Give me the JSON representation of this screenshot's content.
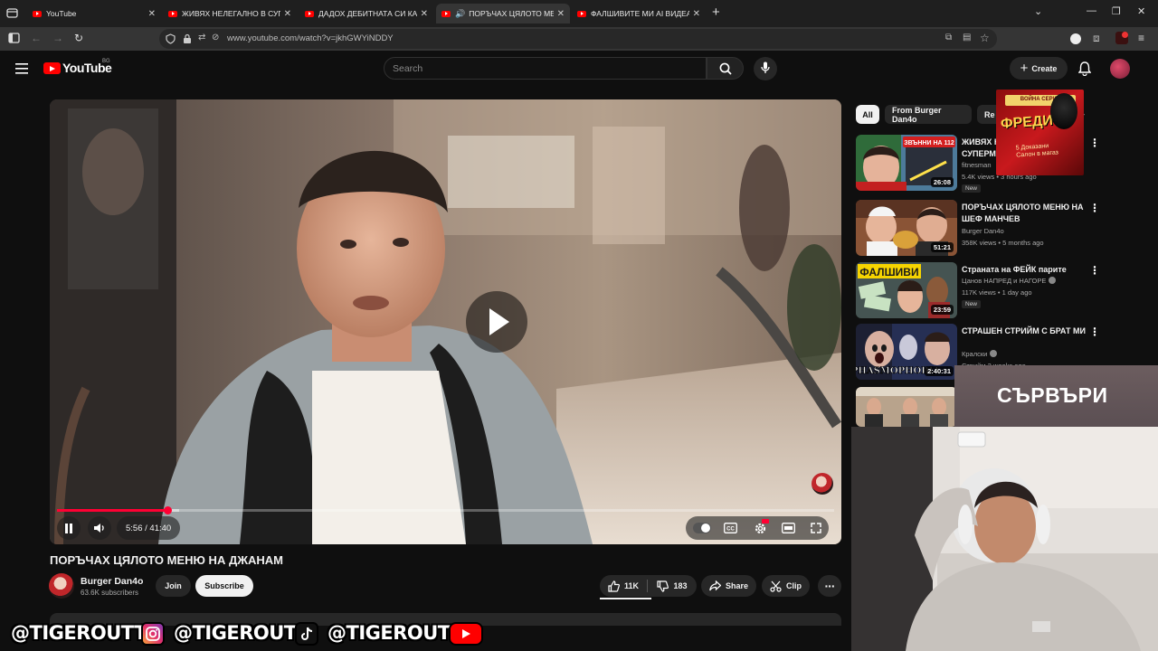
{
  "browser": {
    "tabs": [
      {
        "title": "YouTube"
      },
      {
        "title": "ЖИВЯХ НЕЛЕГАЛНО В СУПЕРМАРКЕТ"
      },
      {
        "title": "ДАДОХ ДЕБИТНАТА СИ КАРТА"
      },
      {
        "title": "ПОРЪЧАХ ЦЯЛОТО МЕНЮ НА ДЖАНАМ"
      },
      {
        "title": "ФАЛШИВИТЕ МИ AI ВИДЕА З..."
      }
    ],
    "new_tab": "+",
    "url": "www.youtube.com/watch?v=jkhGWYiNDDY"
  },
  "header": {
    "logo_text": "YouTube",
    "country": "BG",
    "search_placeholder": "Search",
    "create_label": "Create"
  },
  "player": {
    "time": "5:56 / 41:40",
    "progress": 0.142,
    "buffered": 0.157
  },
  "video": {
    "title": "ПОРЪЧАХ ЦЯЛОТО МЕНЮ НА ДЖАНАМ",
    "channel": "Burger Dan4o",
    "subscribers": "63.6K subscribers",
    "join_label": "Join",
    "subscribe_label": "Subscribe",
    "likes": "11K",
    "dislikes": "183",
    "share_label": "Share",
    "clip_label": "Clip"
  },
  "sidebar": {
    "chips": [
      "All",
      "From Burger Dan4o",
      "Re"
    ],
    "recs": [
      {
        "title": "ЖИВЯХ НЕЛЕГАЛНО В СУПЕРМ...",
        "channel": "fitnesman",
        "views": "5.4K views • 3 hours ago",
        "badge": "New",
        "duration": "26:08"
      },
      {
        "title": "ПОРЪЧАХ ЦЯЛОТО МЕНЮ НА ШЕФ МАНЧЕВ",
        "channel": "Burger Dan4o",
        "views": "358K views • 5 months ago",
        "badge": "",
        "duration": "51:21"
      },
      {
        "title": "Страната на ФЕЙК парите",
        "channel": "Цанов НАПРЕД и НАГОРЕ",
        "views": "117K views • 1 day ago",
        "badge": "New",
        "duration": "23:59"
      },
      {
        "title": "СТРАШЕН СТРИЙМ С БРАТ МИ",
        "channel": "Кралски",
        "views": "Стрийм 2 weeks ago",
        "badge": "",
        "duration": "2:40:31"
      }
    ]
  },
  "overlays": {
    "promo_title": "ФРЕДИ",
    "promo_sub": "5 Доказани\nСалон в магаз",
    "promo_brand": "ВОЙНА СЕРИЯ",
    "servers_text": "СЪРВЪРИ",
    "thumb_text_1": "ЗВЪННИ НА 112",
    "thumb_text_3": "ФАЛШИВИ",
    "thumb_text_4": "PHASMOPHOBIA",
    "social": [
      "@TIGEROUTT",
      "@TIGEROUT",
      "@TIGEROUT"
    ]
  },
  "colors": {
    "youtube_red": "#ff0000",
    "progress_red": "#ff0033",
    "background": "#0f0f0f",
    "chip_bg": "#272727"
  },
  "icons": [
    "menu-icon",
    "search-icon",
    "mic-icon",
    "bell-icon",
    "pause-icon",
    "volume-icon",
    "like-icon",
    "dislike-icon",
    "share-icon",
    "scissors-icon",
    "more-icon",
    "instagram-icon",
    "tiktok-icon",
    "youtube-icon"
  ]
}
